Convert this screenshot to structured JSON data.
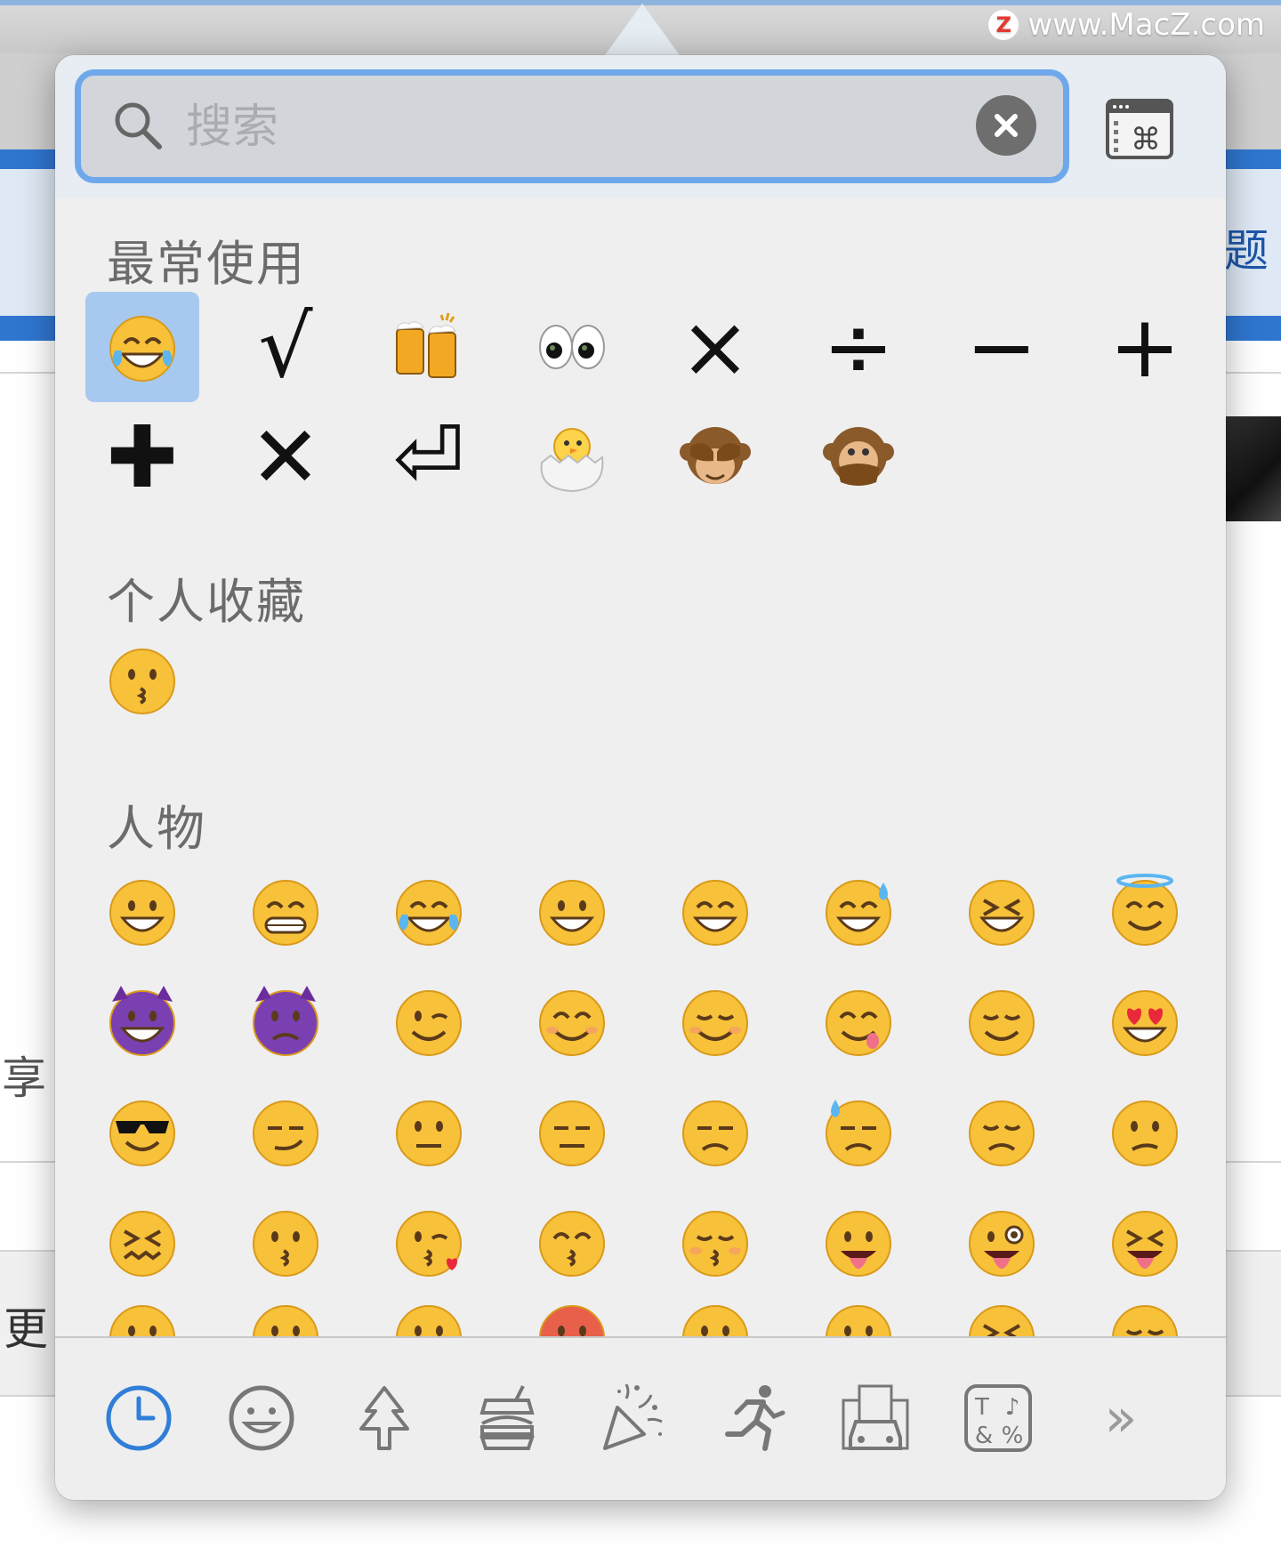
{
  "watermark": {
    "logo_letter": "Z",
    "text": "www.MacZ.com"
  },
  "background": {
    "title_fragment": "题",
    "left_char_1": "享",
    "left_char_2": "更"
  },
  "search": {
    "placeholder": "搜索",
    "value": ""
  },
  "sections": {
    "frequent": "最常使用",
    "favorites": "个人收藏",
    "people": "人物"
  },
  "frequent_items": [
    {
      "kind": "emoji",
      "name": "face-with-tears-of-joy",
      "selected": true
    },
    {
      "kind": "symbol",
      "char": "√",
      "name": "square-root"
    },
    {
      "kind": "emoji",
      "name": "clinking-beer-mugs"
    },
    {
      "kind": "emoji",
      "name": "eyes"
    },
    {
      "kind": "symbol",
      "char": "×",
      "name": "multiplication-sign"
    },
    {
      "kind": "symbol",
      "char": "÷",
      "name": "division-sign"
    },
    {
      "kind": "symbol",
      "char": "−",
      "name": "minus-sign"
    },
    {
      "kind": "symbol",
      "char": "+",
      "name": "plus-sign"
    },
    {
      "kind": "symbol",
      "char": "✚",
      "name": "heavy-plus-sign"
    },
    {
      "kind": "symbol",
      "char": "✕",
      "name": "multiplication-x"
    },
    {
      "kind": "symbol",
      "char": "⏎",
      "name": "return-symbol"
    },
    {
      "kind": "emoji",
      "name": "hatching-chick"
    },
    {
      "kind": "emoji",
      "name": "see-no-evil-monkey"
    },
    {
      "kind": "emoji",
      "name": "speak-no-evil-monkey"
    }
  ],
  "favorite_items": [
    {
      "kind": "emoji",
      "name": "kissing-face"
    }
  ],
  "people_items": [
    "grinning-face",
    "grimacing-face",
    "face-with-tears-of-joy",
    "smiling-face-open-mouth",
    "smiling-face-smiling-eyes-open-mouth",
    "smiling-face-cold-sweat",
    "smiling-face-closed-eyes",
    "smiling-face-halo",
    "smiling-imp",
    "angry-imp",
    "winking-face",
    "smiling-face-smiling-eyes",
    "relaxed-face",
    "face-savouring-food",
    "relieved-face",
    "heart-eyes",
    "sunglasses-face",
    "smirking-face",
    "neutral-face",
    "expressionless-face",
    "unamused-face",
    "downcast-sweat-face",
    "pensive-face",
    "confused-face",
    "confounded-face",
    "kissing-face",
    "face-blowing-kiss",
    "kissing-smiling-eyes",
    "kissing-closed-eyes",
    "tongue-out-face",
    "winking-tongue-face",
    "squinting-tongue-face"
  ],
  "people_partial_row": [
    "frowning",
    "anguished",
    "worried",
    "angry-red",
    "pouting",
    "disappointed",
    "persevering",
    "sleepy"
  ],
  "tabs": [
    {
      "name": "tab-frequent-clock",
      "active": true
    },
    {
      "name": "tab-people-smiley"
    },
    {
      "name": "tab-nature-tree"
    },
    {
      "name": "tab-food-burger"
    },
    {
      "name": "tab-celebration-popper"
    },
    {
      "name": "tab-activity-runner"
    },
    {
      "name": "tab-travel-car"
    },
    {
      "name": "tab-symbols"
    },
    {
      "name": "tab-more",
      "label": "»"
    }
  ],
  "colors": {
    "accent": "#2f7ed8",
    "selected_cell": "#a8c9ef",
    "search_ring": "#6fa8ea",
    "face_yellow": "#f7c13a",
    "imp_purple": "#7a3fb0"
  }
}
